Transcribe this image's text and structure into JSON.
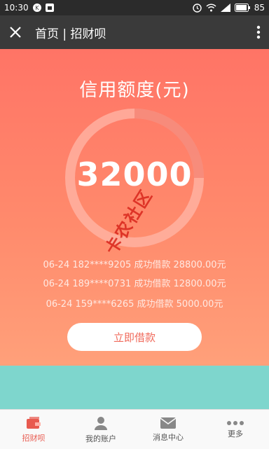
{
  "status_bar": {
    "time": "10:30",
    "battery": "85"
  },
  "app_bar": {
    "title": "首页 | 招财呗"
  },
  "hero": {
    "title": "信用额度(元)",
    "amount": "32000",
    "records": [
      "06-24 182****9205 成功借款 28800.00元",
      "06-24 189****0731 成功借款 12800.00元",
      "06-24 159****6265 成功借款 5000.00元"
    ],
    "button_label": "立即借款"
  },
  "tabs": [
    {
      "label": "招财呗",
      "icon": "wallet-icon",
      "active": true
    },
    {
      "label": "我的账户",
      "icon": "user-icon",
      "active": false
    },
    {
      "label": "消息中心",
      "icon": "mail-icon",
      "active": false
    },
    {
      "label": "更多",
      "icon": "more-icon",
      "active": false
    }
  ],
  "watermark": "卡农社区",
  "colors": {
    "hero_top": "#ff7466",
    "hero_bottom": "#ffa07a",
    "teal": "#7ed6cd",
    "accent": "#e85a4f"
  }
}
